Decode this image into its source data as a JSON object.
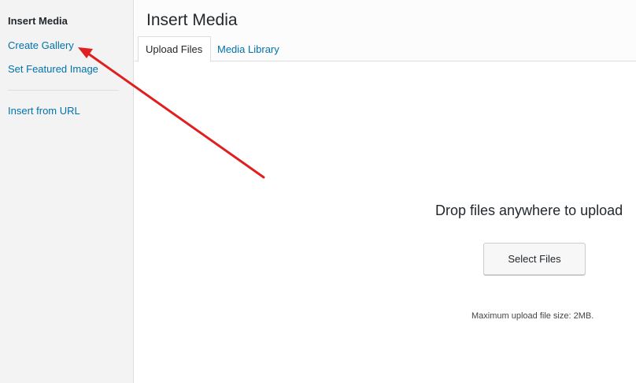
{
  "sidebar": {
    "title": "Insert Media",
    "items": [
      {
        "label": "Create Gallery"
      },
      {
        "label": "Set Featured Image"
      },
      {
        "label": "Insert from URL"
      }
    ]
  },
  "header": {
    "title": "Insert Media",
    "tabs": [
      {
        "label": "Upload Files",
        "active": true
      },
      {
        "label": "Media Library",
        "active": false
      }
    ]
  },
  "uploader": {
    "drop_text": "Drop files anywhere to upload",
    "select_button": "Select Files",
    "max_size_text": "Maximum upload file size: 2MB."
  },
  "colors": {
    "link": "#0073aa",
    "sidebar_bg": "#f3f3f3",
    "annotation_arrow": "#e02020"
  }
}
